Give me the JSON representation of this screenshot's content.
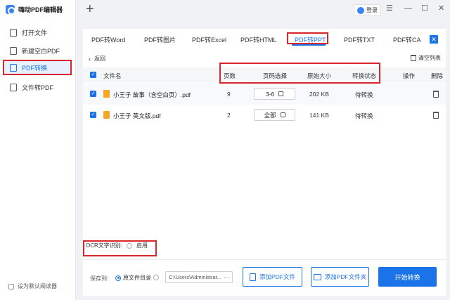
{
  "app": {
    "title": "嗨动PDF编辑器"
  },
  "sidebar": {
    "items": [
      {
        "label": "打开文件"
      },
      {
        "label": "新建空白PDF"
      },
      {
        "label": "PDF转换"
      },
      {
        "label": "文件转PDF"
      }
    ],
    "active_index": 2,
    "default_reader_label": "设为默认阅读器"
  },
  "header": {
    "login_label": "登录"
  },
  "tabs": [
    "PDF转Word",
    "PDF转图片",
    "PDF转Excel",
    "PDF转HTML",
    "PDF转PPT",
    "PDF转TXT",
    "PDF转CAD"
  ],
  "active_tab": "PDF转PPT",
  "toolbar": {
    "back_label": "返回",
    "clear_label": "清空列表"
  },
  "table": {
    "columns": [
      "文件名",
      "页数",
      "页码选择",
      "原始大小",
      "转换状态",
      "操作",
      "删除"
    ],
    "rows": [
      {
        "name": "小王子 故事（含空白页）.pdf",
        "pages": "9",
        "range": "3-6",
        "size": "202 KB",
        "status": "待转换"
      },
      {
        "name": "小王子 英文版.pdf",
        "pages": "2",
        "range": "全部",
        "size": "141 KB",
        "status": "待转换"
      }
    ]
  },
  "ocr": {
    "label": "OCR文字识别:",
    "option_label": "启用"
  },
  "output": {
    "save_label": "保存到:",
    "option_source": "原文件目录",
    "path": "C:\\Users\\Administrat...",
    "more": "···"
  },
  "buttons": {
    "add_file": "添加PDF文件",
    "add_folder": "添加PDF文件夹",
    "start": "开始转换"
  },
  "colors": {
    "accent": "#1a73e8",
    "annotation": "#d9262c",
    "pdf_icon": "#f5a623"
  }
}
